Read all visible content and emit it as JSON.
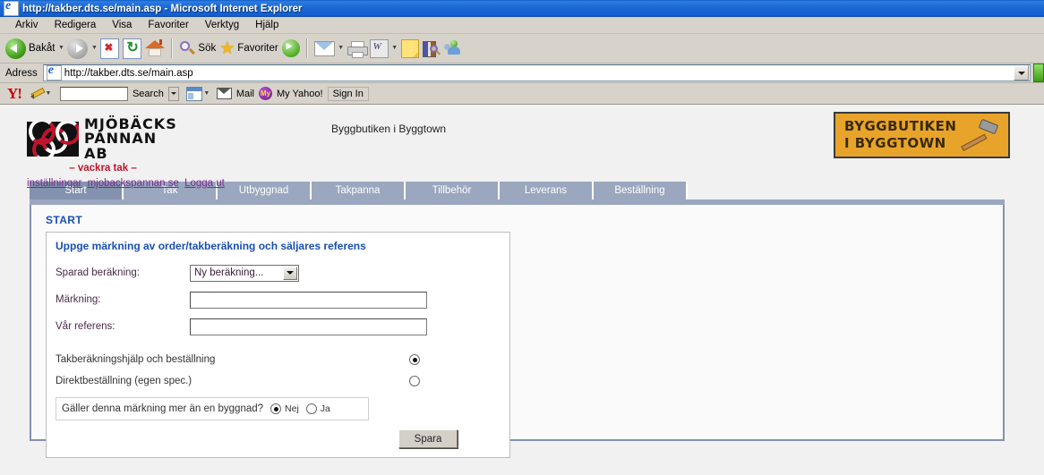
{
  "window": {
    "title": "http://takber.dts.se/main.asp - Microsoft Internet Explorer",
    "doc_icon": "ie-document-icon"
  },
  "menu": {
    "items": [
      "Arkiv",
      "Redigera",
      "Visa",
      "Favoriter",
      "Verktyg",
      "Hjälp"
    ]
  },
  "toolbar": {
    "back_label": "Bakåt",
    "search_label": "Sök",
    "favorites_label": "Favoriter",
    "icons": [
      "back-icon",
      "forward-icon",
      "stop-icon",
      "refresh-icon",
      "home-icon",
      "search-icon",
      "favorites-star-icon",
      "media-icon",
      "mail-icon",
      "print-icon",
      "edit-word-icon",
      "notes-icon",
      "research-icon",
      "messenger-icon"
    ]
  },
  "address": {
    "label": "Adress",
    "url": "http://takber.dts.se/main.asp"
  },
  "yahoo_bar": {
    "logo": "Y!",
    "search_value": "",
    "search_button": "Search",
    "mail": "Mail",
    "my_yahoo": "My Yahoo!",
    "sign_in": "Sign In"
  },
  "header": {
    "logo_line1": "MJÖBÄCKS",
    "logo_line2": "PANNAN AB",
    "tagline": "– vackra tak –",
    "links": [
      {
        "label": "inställningar"
      },
      {
        "label": "mjobackspannan.se"
      },
      {
        "label": "Logga ut"
      }
    ],
    "center_text": "Byggbutiken i Byggtown",
    "banner_line1": "BYGGBUTIKEN",
    "banner_line2": "I BYGGTOWN",
    "banner_color": "#e8a42a",
    "banner_icon": "hammer-icon"
  },
  "tabs": [
    {
      "label": "Start",
      "active": true
    },
    {
      "label": "Tak",
      "active": false
    },
    {
      "label": "Utbyggnad",
      "active": false
    },
    {
      "label": "Takpanna",
      "active": false
    },
    {
      "label": "Tillbehör",
      "active": false
    },
    {
      "label": "Leverans",
      "active": false
    },
    {
      "label": "Beställning",
      "active": false
    }
  ],
  "content": {
    "page_title": "START",
    "form_heading": "Uppge märkning av order/takberäkning och säljares referens",
    "fields": {
      "saved_calc_label": "Sparad beräkning:",
      "saved_calc_value": "Ny beräkning...",
      "marking_label": "Märkning:",
      "marking_value": "",
      "reference_label": "Vår referens:",
      "reference_value": ""
    },
    "options": [
      {
        "label": "Takberäkningshjälp och beställning",
        "selected": true
      },
      {
        "label": "Direktbeställning (egen spec.)",
        "selected": false
      }
    ],
    "inner_question": {
      "text": "Gäller denna märkning mer än en byggnad?",
      "no_label": "Nej",
      "yes_label": "Ja",
      "no_selected": true,
      "yes_selected": false
    },
    "save_button": "Spara"
  },
  "colors": {
    "title_blue": "#1560cf",
    "heading_blue": "#1a4fb0",
    "tab_blue_gray": "#9aa7bf",
    "tab_active": "#8392ae",
    "link_purple": "#7a2a8a",
    "tagline_red": "#c0142c"
  }
}
